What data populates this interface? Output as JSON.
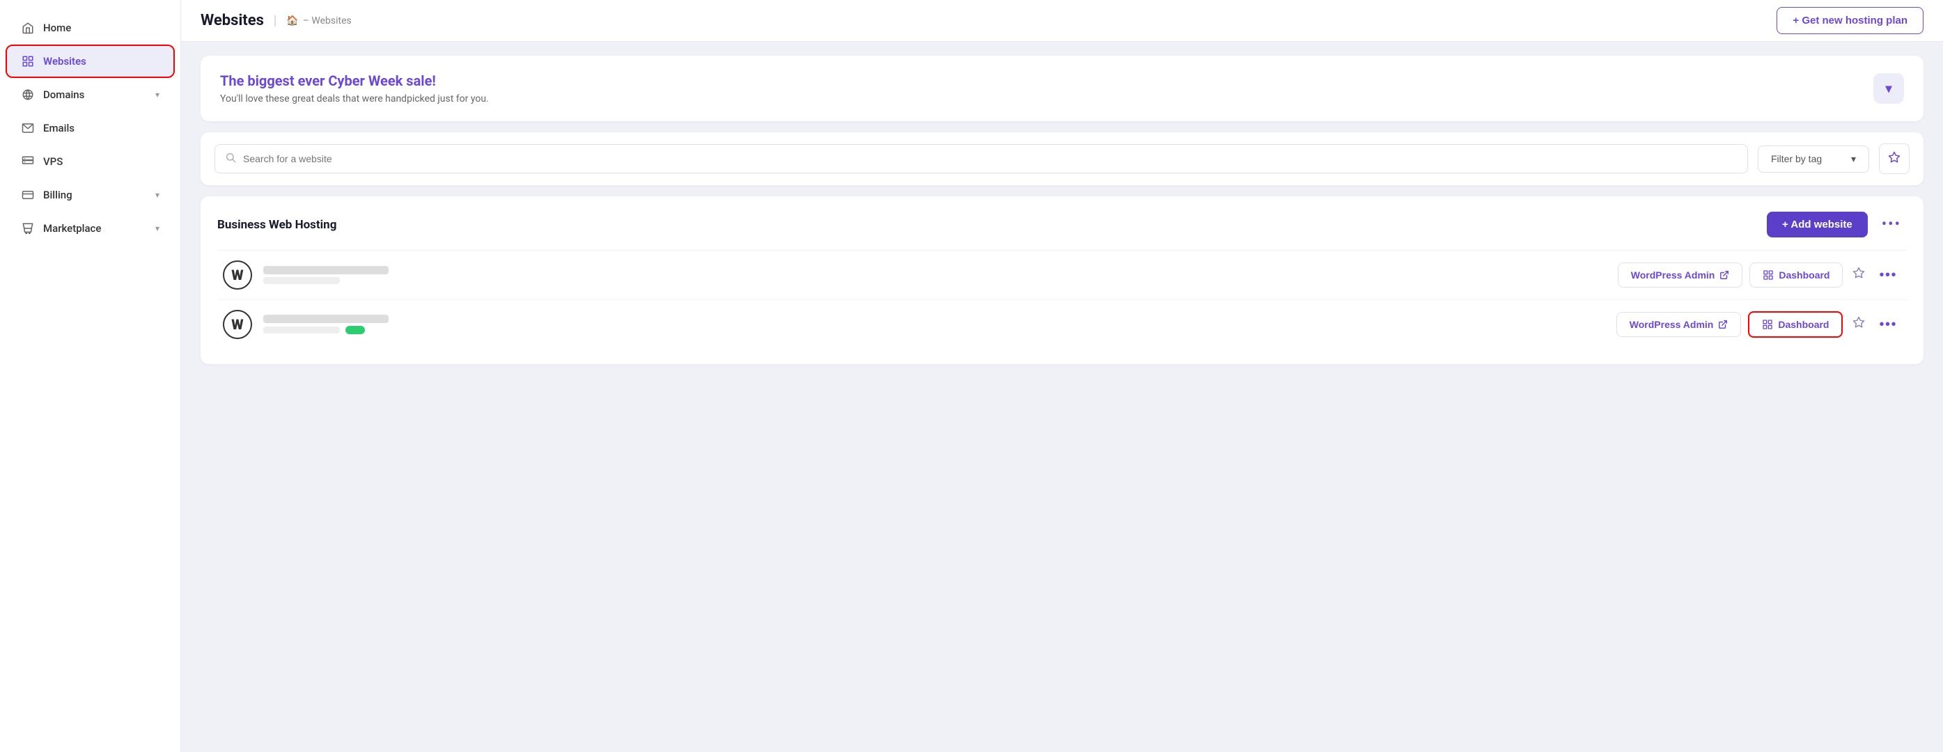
{
  "sidebar": {
    "items": [
      {
        "id": "home",
        "label": "Home",
        "icon": "home",
        "active": false,
        "hasChevron": false
      },
      {
        "id": "websites",
        "label": "Websites",
        "icon": "grid",
        "active": true,
        "hasChevron": false
      },
      {
        "id": "domains",
        "label": "Domains",
        "icon": "globe",
        "active": false,
        "hasChevron": true
      },
      {
        "id": "emails",
        "label": "Emails",
        "icon": "mail",
        "active": false,
        "hasChevron": false
      },
      {
        "id": "vps",
        "label": "VPS",
        "icon": "server",
        "active": false,
        "hasChevron": false
      },
      {
        "id": "billing",
        "label": "Billing",
        "icon": "card",
        "active": false,
        "hasChevron": true
      },
      {
        "id": "marketplace",
        "label": "Marketplace",
        "icon": "store",
        "active": false,
        "hasChevron": true
      }
    ]
  },
  "header": {
    "title": "Websites",
    "breadcrumb_sep": "– Websites",
    "get_plan_label": "+ Get new hosting plan"
  },
  "banner": {
    "heading_prefix": "The biggest ever ",
    "heading_highlight": "Cyber Week",
    "heading_suffix": " sale!",
    "subtext": "You'll love these great deals that were handpicked just for you."
  },
  "search": {
    "placeholder": "Search for a website",
    "filter_label": "Filter by tag",
    "star_aria": "Favorites filter"
  },
  "hosting_section": {
    "title": "Business Web Hosting",
    "add_button": "+ Add website",
    "websites": [
      {
        "id": "site1",
        "wp_admin_label": "WordPress Admin",
        "dashboard_label": "Dashboard",
        "highlighted_dashboard": false
      },
      {
        "id": "site2",
        "wp_admin_label": "WordPress Admin",
        "dashboard_label": "Dashboard",
        "highlighted_dashboard": true
      }
    ]
  }
}
